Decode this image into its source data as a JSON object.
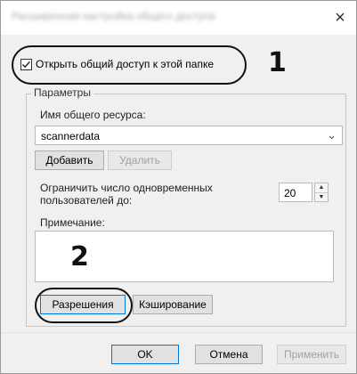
{
  "window": {
    "title": "Расширенная настройка общего доступа",
    "close_glyph": "×"
  },
  "share_checkbox": {
    "label": "Открыть общий доступ к этой папке",
    "checked": true
  },
  "callouts": {
    "one": "1",
    "two": "2"
  },
  "params": {
    "legend": "Параметры",
    "share_name_label": "Имя общего ресурса:",
    "share_name_value": "scannerdata",
    "add_button": "Добавить",
    "remove_button": "Удалить",
    "limit_label_line1": "Ограничить число одновременных",
    "limit_label_line2": "пользователей до:",
    "limit_value": "20",
    "comment_label": "Примечание:",
    "comment_value": "",
    "permissions_button": "Разрешения",
    "caching_button": "Кэширование"
  },
  "footer": {
    "ok": "OK",
    "cancel": "Отмена",
    "apply": "Применить"
  },
  "colors": {
    "dialog_bg": "#f0f0f0",
    "accent": "#0078d7",
    "disabled_text": "#a0a0a0"
  }
}
